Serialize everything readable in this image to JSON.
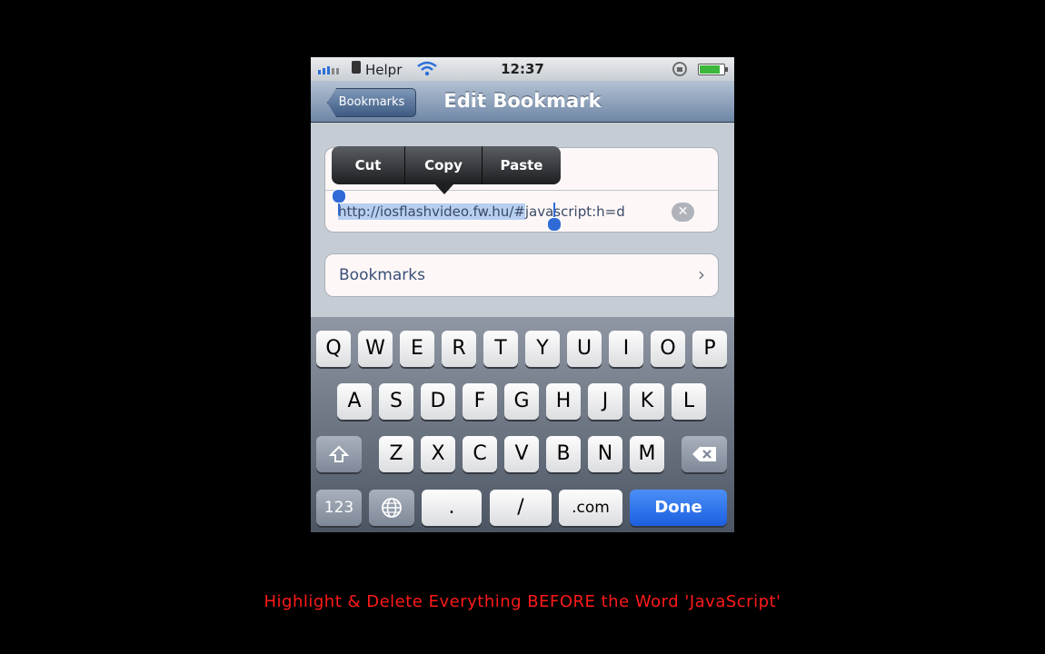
{
  "status_bar": {
    "carrier": "Helpr",
    "time": "12:37",
    "battery_level": 0.85,
    "icons": [
      "signal-icon",
      "wifi-icon",
      "rotation-lock-icon",
      "battery-icon"
    ]
  },
  "nav": {
    "back_label": "Bookmarks",
    "title": "Edit Bookmark"
  },
  "edit_menu": {
    "cut": "Cut",
    "copy": "Copy",
    "paste": "Paste"
  },
  "url_field": {
    "selected": "http://iosflashvideo.fw.hu/#",
    "rest": "javascript:h=d"
  },
  "folder_row": {
    "label": "Bookmarks"
  },
  "keyboard": {
    "row1": [
      "Q",
      "W",
      "E",
      "R",
      "T",
      "Y",
      "U",
      "I",
      "O",
      "P"
    ],
    "row2": [
      "A",
      "S",
      "D",
      "F",
      "G",
      "H",
      "J",
      "K",
      "L"
    ],
    "row3": [
      "Z",
      "X",
      "C",
      "V",
      "B",
      "N",
      "M"
    ],
    "numbers": "123",
    "dot": ".",
    "slash": "/",
    "dotcom": ".com",
    "done": "Done"
  },
  "caption": "Highlight & Delete Everything BEFORE the Word 'JavaScript'",
  "colors": {
    "caption": "#ff1a1a",
    "done_key": "#1b5fe0",
    "selection": "#b7cff0"
  }
}
